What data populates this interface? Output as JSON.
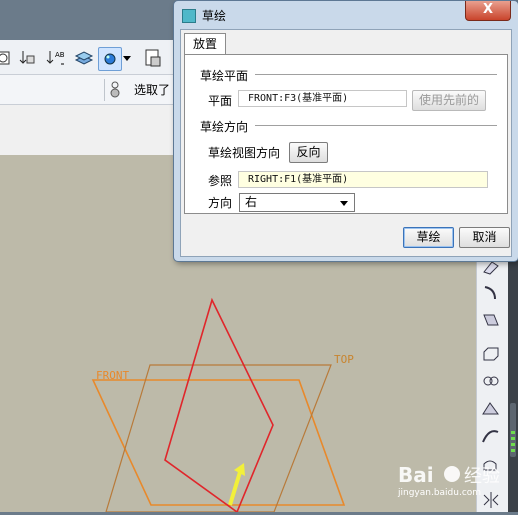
{
  "dialog": {
    "title": "草绘",
    "close": "X",
    "tab_label": "放置",
    "plane_section": "草绘平面",
    "plane_label": "平面",
    "plane_value": "FRONT:F3(基准平面)",
    "use_previous": "使用先前的",
    "orient_section": "草绘方向",
    "view_dir_label": "草绘视图方向",
    "flip_button": "反向",
    "ref_label": "参照",
    "ref_value": "RIGHT:F1(基准平面)",
    "dir_label": "方向",
    "dir_value": "右",
    "sketch_button": "草绘",
    "cancel_button": "取消"
  },
  "toolbar": {
    "pick_label": "选取了"
  },
  "canvas": {
    "front_label": "FRONT",
    "top_label": "TOP"
  },
  "watermark": {
    "site": "jingyan.baidu.com"
  },
  "colors": {
    "dialog_frame": "#c9d9ea",
    "canvas": "#bdbaa9",
    "plane_orange": "#e8892b",
    "sketch_red": "#e0262b",
    "arrow_yellow": "#f2f03a"
  }
}
